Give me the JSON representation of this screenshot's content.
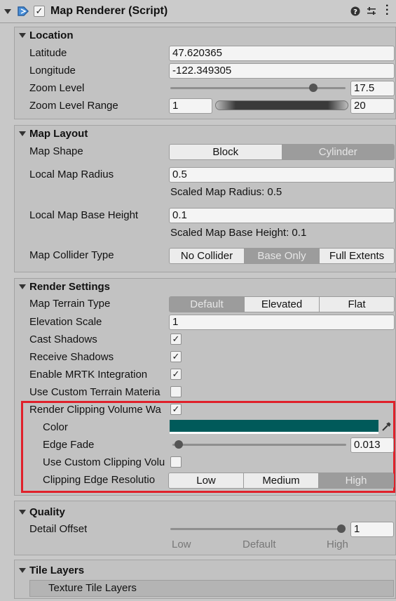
{
  "header": {
    "title": "Map Renderer (Script)",
    "enabled": true
  },
  "location": {
    "title": "Location",
    "latitude_label": "Latitude",
    "latitude": "47.620365",
    "longitude_label": "Longitude",
    "longitude": "-122.349305",
    "zoom_label": "Zoom Level",
    "zoom": "17.5",
    "zoom_fraction": 0.83,
    "zoom_range_label": "Zoom Level Range",
    "zoom_min": "1",
    "zoom_max": "20"
  },
  "layout": {
    "title": "Map Layout",
    "shape_label": "Map Shape",
    "shape_options": [
      "Block",
      "Cylinder"
    ],
    "shape_selected": "Cylinder",
    "radius_label": "Local Map Radius",
    "radius": "0.5",
    "scaled_radius": "Scaled Map Radius: 0.5",
    "base_height_label": "Local Map Base Height",
    "base_height": "0.1",
    "scaled_base_height": "Scaled Map Base Height: 0.1",
    "collider_label": "Map Collider Type",
    "collider_options": [
      "No Collider",
      "Base Only",
      "Full Extents"
    ],
    "collider_selected": "Base Only"
  },
  "render": {
    "title": "Render Settings",
    "terrain_label": "Map Terrain Type",
    "terrain_options": [
      "Default",
      "Elevated",
      "Flat"
    ],
    "terrain_selected": "Default",
    "elevation_label": "Elevation Scale",
    "elevation": "1",
    "cast_label": "Cast Shadows",
    "cast": true,
    "receive_label": "Receive Shadows",
    "receive": true,
    "mrtk_label": "Enable MRTK Integration",
    "mrtk": true,
    "custom_terrain_label": "Use Custom Terrain Materia",
    "custom_terrain": false,
    "clip_label": "Render Clipping Volume Wa",
    "clip": true,
    "color_label": "Color",
    "color": "#005a5a",
    "edge_fade_label": "Edge Fade",
    "edge_fade": "0.013",
    "edge_fade_fraction": 0.013,
    "custom_clip_label": "Use Custom Clipping Volu",
    "custom_clip": false,
    "edge_res_label": "Clipping Edge Resolutio",
    "edge_res_options": [
      "Low",
      "Medium",
      "High"
    ],
    "edge_res_selected": "High"
  },
  "quality": {
    "title": "Quality",
    "detail_label": "Detail Offset",
    "detail": "1",
    "detail_fraction": 1.0,
    "ticks": [
      "Low",
      "Default",
      "High"
    ]
  },
  "tiles": {
    "title": "Tile Layers",
    "texture_label": "Texture Tile Layers"
  },
  "highlight_color": "#e0202a"
}
